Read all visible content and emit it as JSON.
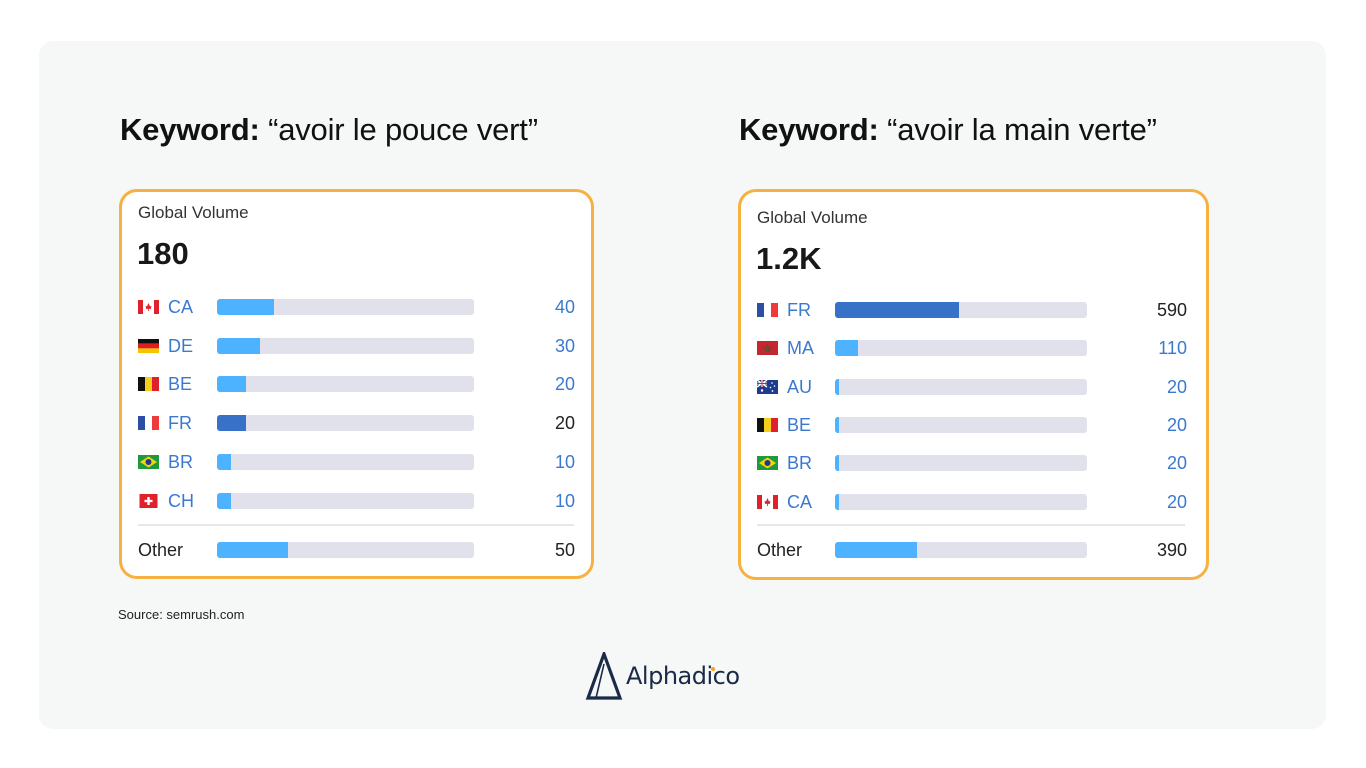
{
  "panels": [
    {
      "keyword_label": "Keyword:",
      "keyword_value": "“avoir le pouce vert”",
      "global_volume_label": "Global Volume",
      "global_volume_total": "180",
      "divider_before_other": true
    },
    {
      "keyword_label": "Keyword:",
      "keyword_value": "“avoir la main verte”",
      "global_volume_label": "Global Volume",
      "global_volume_total": "1.2K",
      "divider_before_other": true
    }
  ],
  "source": "Source: semrush.com",
  "logo": {
    "name": "Alphadico",
    "icon": "triangle-a-logo-icon"
  },
  "colors": {
    "card_border": "#f7b140",
    "bar_light": "#4db2ff",
    "bar_dark": "#3771c8",
    "bar_track": "#e0e1ea",
    "code_link": "#3b78d0",
    "value_dark": "#222222",
    "logo_navy": "#1b2a47",
    "logo_accent": "#f7a21b"
  },
  "chart_data": [
    {
      "type": "bar",
      "orientation": "horizontal",
      "title": "Keyword: “avoir le pouce vert” — Global Volume",
      "total_label": "180",
      "total": 180,
      "categories": [
        "CA",
        "DE",
        "BE",
        "FR",
        "BR",
        "CH",
        "Other"
      ],
      "flags": [
        "flag-ca-icon",
        "flag-de-icon",
        "flag-be-icon",
        "flag-fr-icon",
        "flag-br-icon",
        "flag-ch-icon",
        null
      ],
      "values": [
        40,
        30,
        20,
        20,
        10,
        10,
        50
      ],
      "value_labels": [
        "40",
        "30",
        "20",
        "20",
        "10",
        "10",
        "50"
      ],
      "highlight": [
        "light",
        "light",
        "light",
        "dark",
        "light",
        "light",
        "light"
      ],
      "value_style": [
        "link",
        "link",
        "link",
        "plain",
        "link",
        "link",
        "plain"
      ],
      "xlim": [
        0,
        180
      ]
    },
    {
      "type": "bar",
      "orientation": "horizontal",
      "title": "Keyword: “avoir la main verte” — Global Volume",
      "total_label": "1.2K",
      "total": 1200,
      "categories": [
        "FR",
        "MA",
        "AU",
        "BE",
        "BR",
        "CA",
        "Other"
      ],
      "flags": [
        "flag-fr-icon",
        "flag-ma-icon",
        "flag-au-icon",
        "flag-be-icon",
        "flag-br-icon",
        "flag-ca-icon",
        null
      ],
      "values": [
        590,
        110,
        20,
        20,
        20,
        20,
        390
      ],
      "value_labels": [
        "590",
        "110",
        "20",
        "20",
        "20",
        "20",
        "390"
      ],
      "highlight": [
        "dark",
        "light",
        "light",
        "light",
        "light",
        "light",
        "light"
      ],
      "value_style": [
        "plain",
        "link",
        "link",
        "link",
        "link",
        "link",
        "plain"
      ],
      "xlim": [
        0,
        1200
      ]
    }
  ]
}
